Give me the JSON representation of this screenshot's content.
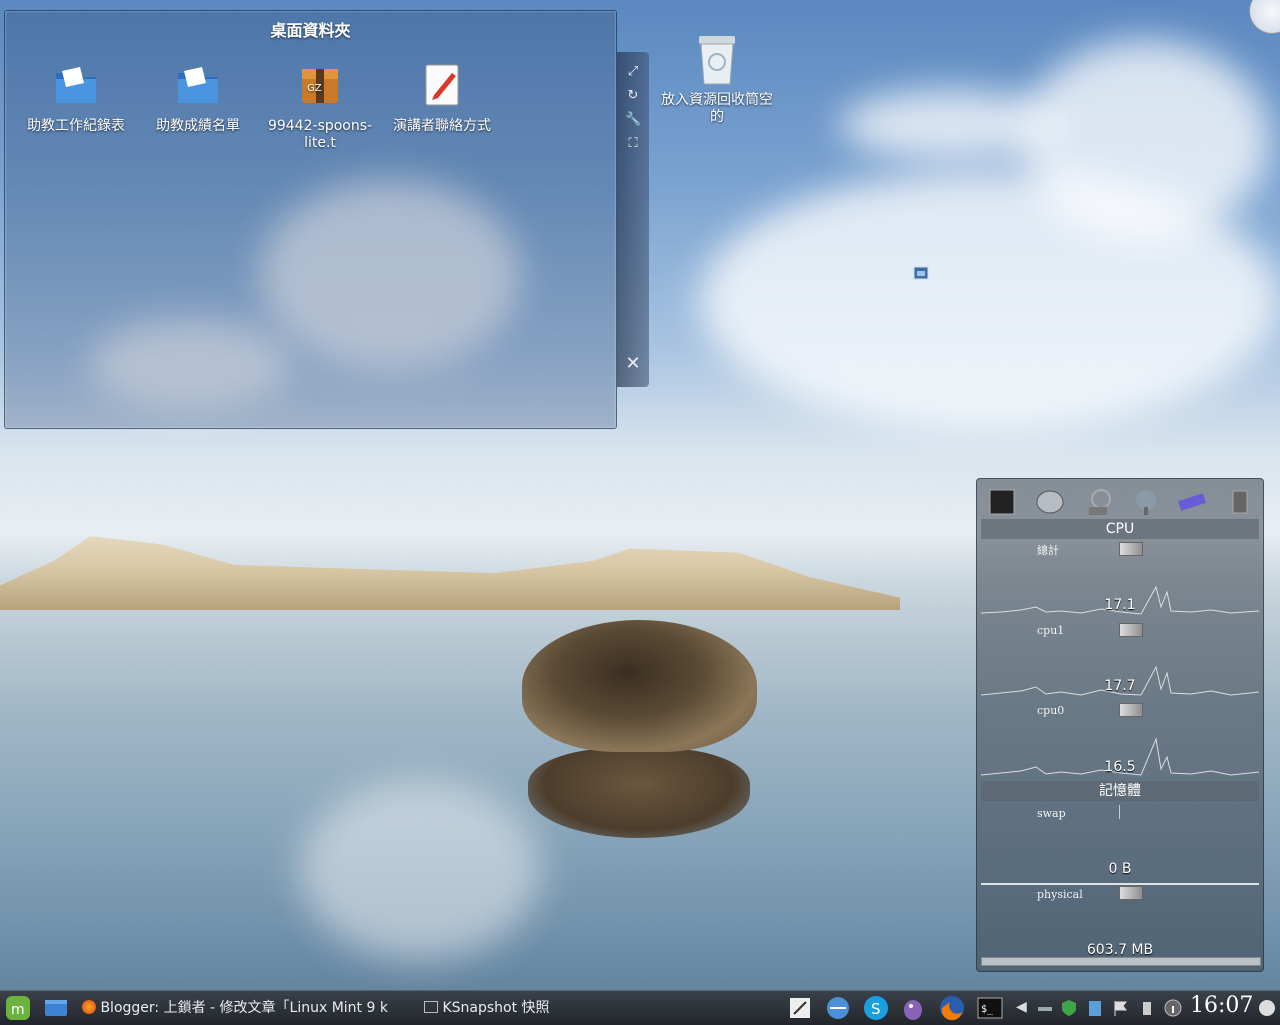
{
  "desktop": {
    "folderview": {
      "title": "桌面資料夾",
      "items": [
        {
          "label": "助教工作紀錄表",
          "icon": "blue-folder-icon"
        },
        {
          "label": "助教成績名單",
          "icon": "blue-folder-icon"
        },
        {
          "label": "99442-spoons-lite.t",
          "icon": "archive-gz-icon"
        },
        {
          "label": "演講者聯絡方式",
          "icon": "text-editor-icon"
        }
      ]
    },
    "trash": {
      "label": "放入資源回收筒空的",
      "icon": "trash-icon"
    }
  },
  "sysmon": {
    "cpu_title": "CPU",
    "rows": [
      {
        "label": "總計",
        "value": "17.1"
      },
      {
        "label": "cpu1",
        "value": "17.7"
      },
      {
        "label": "cpu0",
        "value": "16.5"
      }
    ],
    "mem_title": "記憶體",
    "mem_rows": [
      {
        "label": "swap",
        "value": "0 B"
      },
      {
        "label": "physical",
        "value": "603.7 MB"
      }
    ]
  },
  "taskbar": {
    "tasks": [
      {
        "label": "Blogger: 上鎖者 - 修改文章「Linux Mint 9 k"
      },
      {
        "label": "KSnapshot 快照"
      }
    ],
    "clock": "16:07"
  },
  "colors": {
    "panel": "#262a30",
    "accent": "#4a8fd8"
  }
}
